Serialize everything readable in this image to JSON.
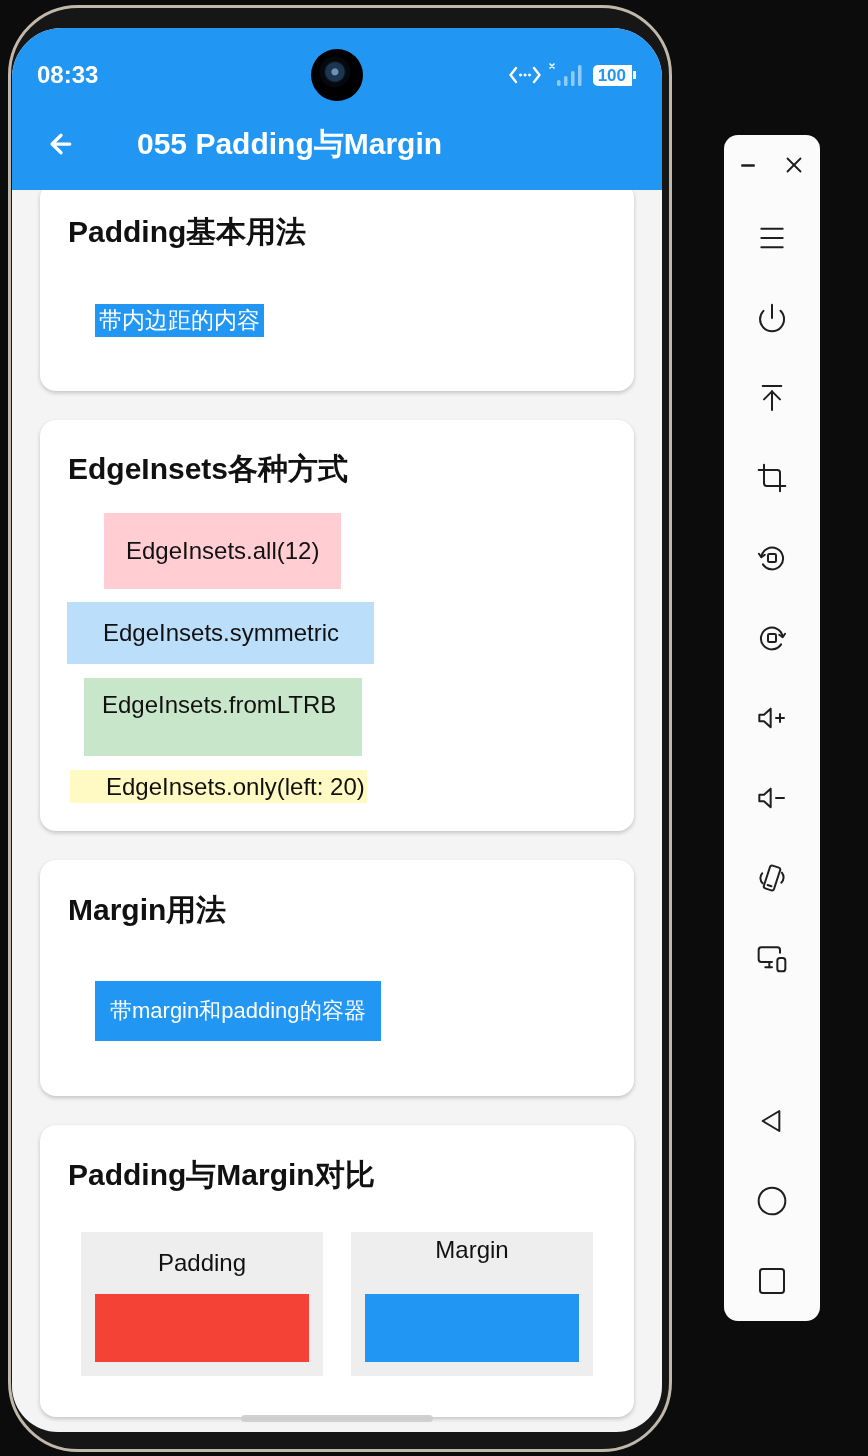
{
  "status_bar": {
    "time": "08:33",
    "battery": "100"
  },
  "app_bar": {
    "title": "055 Padding与Margin"
  },
  "cards": [
    {
      "kind": "padded-text",
      "title": "Padding基本用法",
      "text": "带内边距的内容"
    },
    {
      "kind": "insets",
      "title": "EdgeInsets各种方式",
      "items": [
        {
          "text": "EdgeInsets.all(12)",
          "color": "#ffcdd2"
        },
        {
          "text": "EdgeInsets.symmetric",
          "color": "#bbdefb"
        },
        {
          "text": "EdgeInsets.fromLTRB",
          "color": "#c8e6c9"
        },
        {
          "text": "EdgeInsets.only(left: 20)",
          "color": "#fff9c4"
        }
      ]
    },
    {
      "kind": "margin-box",
      "title": "Margin用法",
      "text": "带margin和padding的容器"
    },
    {
      "kind": "compare",
      "title": "Padding与Margin对比",
      "panels": [
        {
          "label": "Padding",
          "color": "#f44336"
        },
        {
          "label": "Margin",
          "color": "#2196f3"
        }
      ]
    }
  ]
}
